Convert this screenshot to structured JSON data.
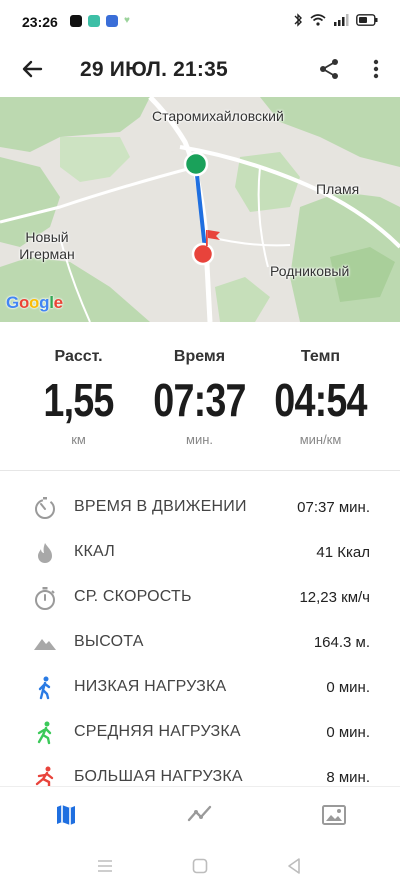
{
  "status_bar": {
    "time": "23:26",
    "app_colors": [
      "#111111",
      "#3dbfa6",
      "#3a6ed8"
    ]
  },
  "header": {
    "title": "29 ИЮЛ. 21:35",
    "back_icon": "arrow-back-icon",
    "share_icon": "share-icon",
    "more_icon": "more-vert-icon"
  },
  "map": {
    "labels": {
      "top": "Старомихайловский",
      "flame": "Пламя",
      "new_igerman": "Новый\nИгерман",
      "rodnikovy": "Родниковый"
    },
    "attribution": "Google",
    "route_color": "#1f6fe0",
    "start_color": "#1aa15a",
    "finish_color": "#e8433b"
  },
  "summary": {
    "distance": {
      "label": "Расст.",
      "value": "1,55",
      "unit": "км"
    },
    "time": {
      "label": "Время",
      "value": "07:37",
      "unit": "мин."
    },
    "pace": {
      "label": "Темп",
      "value": "04:54",
      "unit": "мин/км"
    }
  },
  "details": [
    {
      "icon": "stopwatch-motion-icon",
      "label": "ВРЕМЯ В ДВИЖЕНИИ",
      "value": "07:37 мин."
    },
    {
      "icon": "flame-icon",
      "label": "ККАЛ",
      "value": "41 Ккал"
    },
    {
      "icon": "stopwatch-icon",
      "label": "СР. СКОРОСТЬ",
      "value": "12,23 км/ч"
    },
    {
      "icon": "mountain-icon",
      "label": "ВЫСОТА",
      "value": "164.3 м."
    },
    {
      "icon": "walker-low-icon",
      "label": "НИЗКАЯ НАГРУЗКА",
      "value": "0 мин."
    },
    {
      "icon": "walker-medium-icon",
      "label": "СРЕДНЯЯ НАГРУЗКА",
      "value": "0 мин."
    },
    {
      "icon": "runner-high-icon",
      "label": "БОЛЬШАЯ НАГРУЗКА",
      "value": "8 мин."
    }
  ],
  "colors": {
    "low_load": "#2a7be4",
    "medium_load": "#3cc95a",
    "high_load": "#e8433b",
    "nav_active": "#1f6fe0"
  },
  "bottom_nav": [
    "map-icon",
    "chart-line-icon",
    "image-icon"
  ]
}
